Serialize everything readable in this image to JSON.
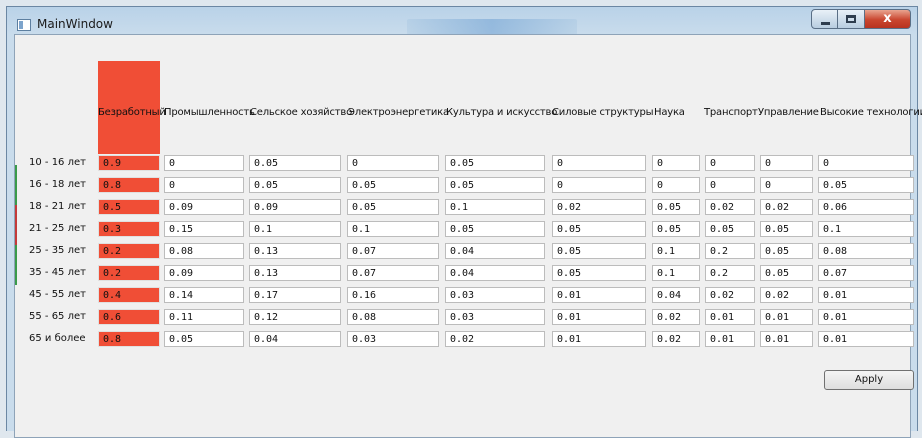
{
  "window": {
    "title": "MainWindow",
    "close_glyph": "x"
  },
  "headers": [
    "Безработный",
    "Промышленность",
    "Сельское хозяйство",
    "Электроэнергетика",
    "Культура и искусство",
    "Силовые структуры",
    "Наука",
    "Транспорт",
    "Управление",
    "Высокие технологии"
  ],
  "rows": [
    {
      "label": "10 - 16 лет",
      "values": [
        "0.9",
        "0",
        "0.05",
        "0",
        "0.05",
        "0",
        "0",
        "0",
        "0",
        "0"
      ]
    },
    {
      "label": "16 - 18 лет",
      "values": [
        "0.8",
        "0",
        "0.05",
        "0.05",
        "0.05",
        "0",
        "0",
        "0",
        "0",
        "0.05"
      ]
    },
    {
      "label": "18 - 21 лет",
      "values": [
        "0.5",
        "0.09",
        "0.09",
        "0.05",
        "0.1",
        "0.02",
        "0.05",
        "0.02",
        "0.02",
        "0.06"
      ]
    },
    {
      "label": "21 - 25 лет",
      "values": [
        "0.3",
        "0.15",
        "0.1",
        "0.1",
        "0.05",
        "0.05",
        "0.05",
        "0.05",
        "0.05",
        "0.1"
      ]
    },
    {
      "label": "25 - 35 лет",
      "values": [
        "0.2",
        "0.08",
        "0.13",
        "0.07",
        "0.04",
        "0.05",
        "0.1",
        "0.2",
        "0.05",
        "0.08"
      ]
    },
    {
      "label": "35 - 45 лет",
      "values": [
        "0.2",
        "0.09",
        "0.13",
        "0.07",
        "0.04",
        "0.05",
        "0.1",
        "0.2",
        "0.05",
        "0.07"
      ]
    },
    {
      "label": "45 - 55 лет",
      "values": [
        "0.4",
        "0.14",
        "0.17",
        "0.16",
        "0.03",
        "0.01",
        "0.04",
        "0.02",
        "0.02",
        "0.01"
      ]
    },
    {
      "label": "55 - 65 лет",
      "values": [
        "0.6",
        "0.11",
        "0.12",
        "0.08",
        "0.03",
        "0.01",
        "0.02",
        "0.01",
        "0.01",
        "0.01"
      ]
    },
    {
      "label": "65 и более",
      "values": [
        "0.8",
        "0.05",
        "0.04",
        "0.03",
        "0.02",
        "0.01",
        "0.02",
        "0.01",
        "0.01",
        "0.01"
      ]
    }
  ],
  "apply_label": "Apply",
  "colors": {
    "highlight": "#f04e36"
  }
}
